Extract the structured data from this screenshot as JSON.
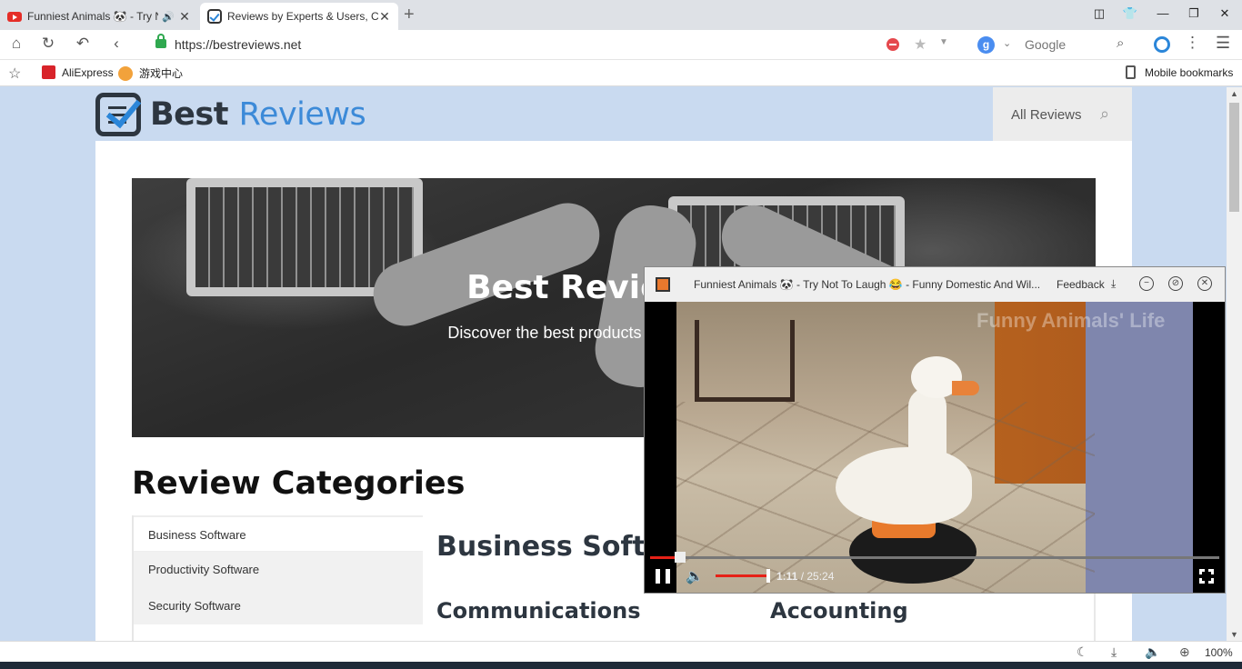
{
  "tabs": [
    {
      "title": "Funniest Animals 🐼 - Try Not To Laugh",
      "active": false,
      "has_audio": true
    },
    {
      "title": "Reviews by Experts & Users, Compare",
      "active": true
    }
  ],
  "toolbar": {
    "url": "https://bestreviews.net",
    "search_engine_letter": "g",
    "search_placeholder": "Google"
  },
  "bookmarks": {
    "items": [
      {
        "label": "AliExpress"
      },
      {
        "label": "游戏中心"
      }
    ],
    "mobile_label": "Mobile bookmarks"
  },
  "site": {
    "logo_dark": "Best",
    "logo_blue": "Reviews",
    "nav_label": "All Reviews",
    "hero_title": "Best Reviews, B",
    "hero_subtitle": "Discover the best products and services throu",
    "categories_heading": "Review Categories",
    "categories": [
      {
        "label": "Business Software",
        "selected": true
      },
      {
        "label": "Productivity Software",
        "selected": false
      },
      {
        "label": "Security Software",
        "selected": false
      }
    ],
    "panel_heading": "Business Softwa",
    "subheads": [
      "Communications",
      "Accounting"
    ]
  },
  "video": {
    "title": "Funniest Animals 🐼 - Try Not To Laugh 😂 - Funny Domestic And Wil...",
    "feedback_label": "Feedback",
    "watermark": "Funny Animals' Life",
    "current_time": "1:11",
    "duration": "25:24",
    "progress_fraction": 0.047,
    "volume_fraction": 1.0,
    "playing": true
  },
  "status": {
    "zoom": "100%"
  },
  "colors": {
    "page_bg": "#c9daf0",
    "brand_blue": "#3c8ad8",
    "youtube_red": "#e62117"
  }
}
